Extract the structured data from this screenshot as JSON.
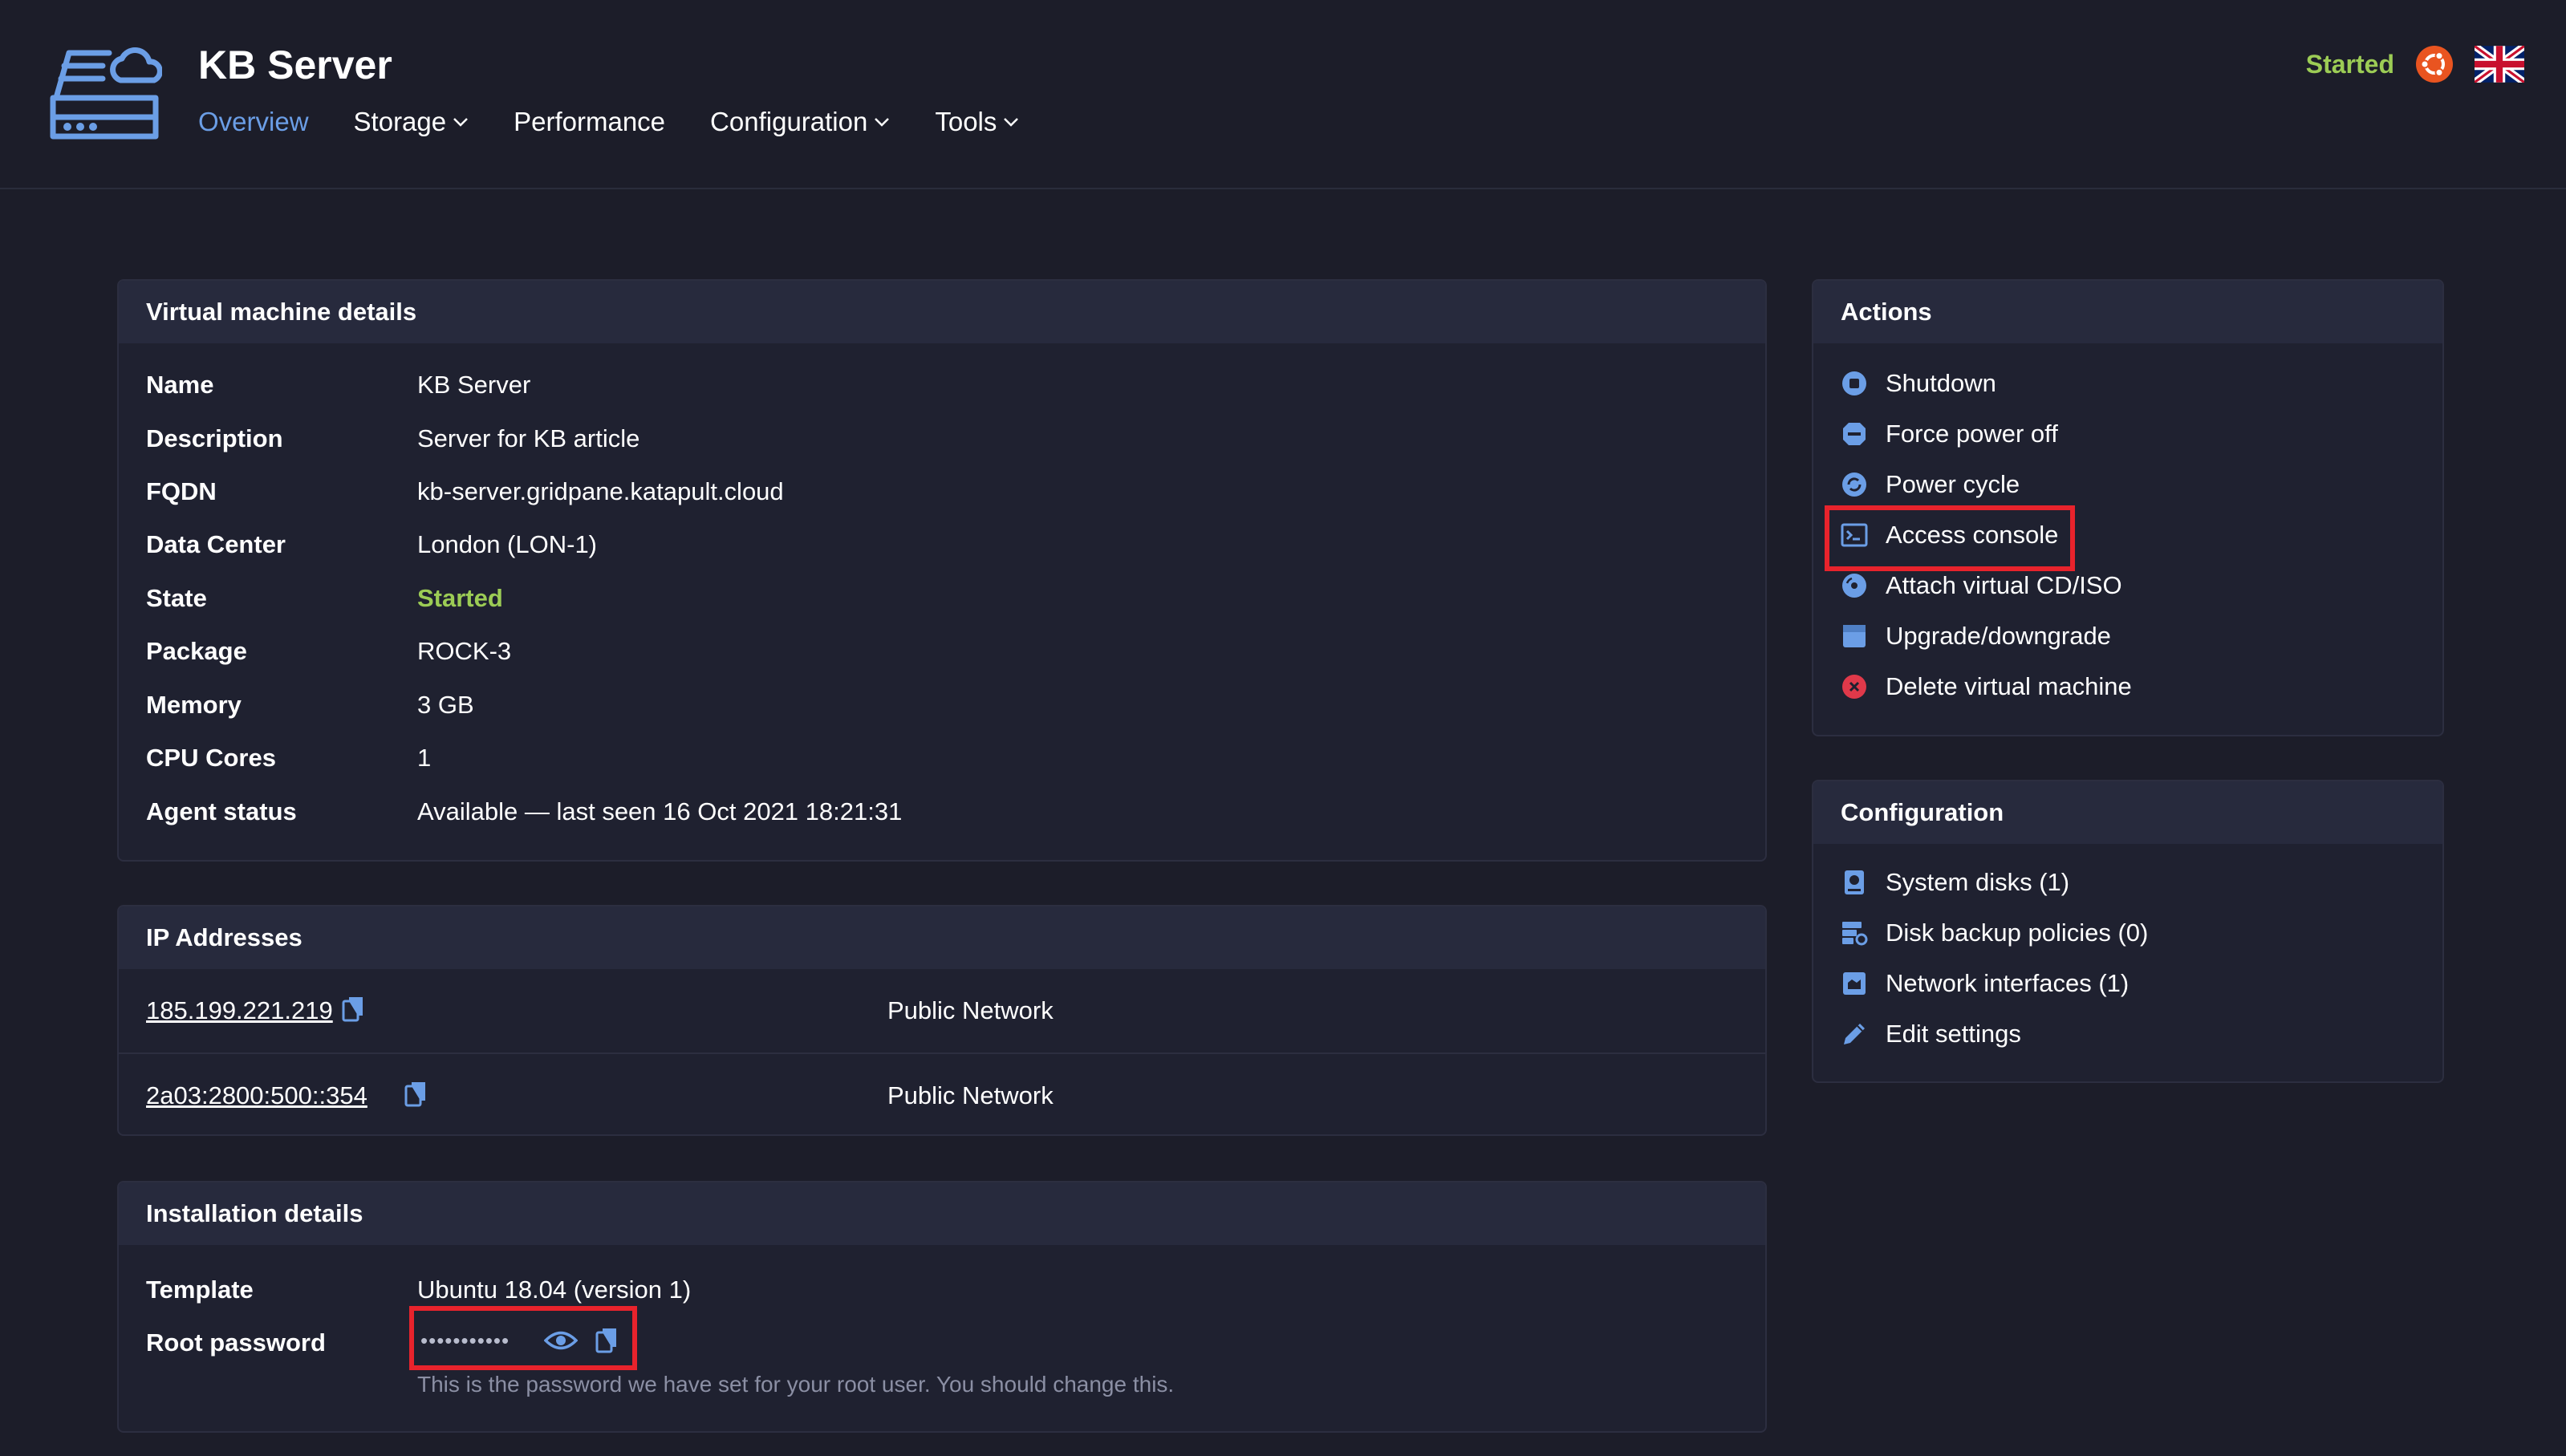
{
  "header": {
    "title": "KB Server",
    "status": "Started",
    "icons": [
      "server-cloud-logo",
      "ubuntu-icon",
      "uk-flag-icon"
    ],
    "nav": [
      {
        "label": "Overview",
        "active": true
      },
      {
        "label": "Storage",
        "dropdown": true
      },
      {
        "label": "Performance"
      },
      {
        "label": "Configuration",
        "dropdown": true
      },
      {
        "label": "Tools",
        "dropdown": true
      }
    ]
  },
  "vm_details": {
    "heading": "Virtual machine details",
    "rows": [
      {
        "key": "Name",
        "value": "KB Server"
      },
      {
        "key": "Description",
        "value": "Server for KB article"
      },
      {
        "key": "FQDN",
        "value": "kb-server.gridpane.katapult.cloud"
      },
      {
        "key": "Data Center",
        "value": "London (LON-1)"
      },
      {
        "key": "State",
        "value": "Started"
      },
      {
        "key": "Package",
        "value": "ROCK-3"
      },
      {
        "key": "Memory",
        "value": "3 GB"
      },
      {
        "key": "CPU Cores",
        "value": "1"
      },
      {
        "key": "Agent status",
        "value": "Available — last seen 16 Oct 2021 18:21:31"
      }
    ]
  },
  "ip_addresses": {
    "heading": "IP Addresses",
    "rows": [
      {
        "address": "185.199.221.219",
        "network": "Public Network"
      },
      {
        "address": "2a03:2800:500::354",
        "network": "Public Network"
      }
    ]
  },
  "installation": {
    "heading": "Installation details",
    "template_key": "Template",
    "template_value": "Ubuntu 18.04 (version 1)",
    "password_key": "Root password",
    "password_mask": "•••••••••••",
    "hint": "This is the password we have set for your root user. You should change this."
  },
  "actions": {
    "heading": "Actions",
    "items": [
      {
        "label": "Shutdown",
        "icon": "stop-circle-icon"
      },
      {
        "label": "Force power off",
        "icon": "stop-sign-icon"
      },
      {
        "label": "Power cycle",
        "icon": "refresh-icon"
      },
      {
        "label": "Access console",
        "icon": "terminal-icon"
      },
      {
        "label": "Attach virtual CD/ISO",
        "icon": "disc-icon"
      },
      {
        "label": "Upgrade/downgrade",
        "icon": "package-icon"
      },
      {
        "label": "Delete virtual machine",
        "icon": "delete-icon"
      }
    ]
  },
  "configuration": {
    "heading": "Configuration",
    "items": [
      {
        "label": "System disks (1)",
        "icon": "disk-icon"
      },
      {
        "label": "Disk backup policies (0)",
        "icon": "backup-icon"
      },
      {
        "label": "Network interfaces (1)",
        "icon": "network-icon"
      },
      {
        "label": "Edit settings",
        "icon": "pencil-icon"
      }
    ]
  },
  "colors": {
    "accent": "#6b9ee6",
    "started": "#9ccc55",
    "danger": "#e0394a",
    "highlight": "#e8232c",
    "background": "#1c1d29"
  }
}
